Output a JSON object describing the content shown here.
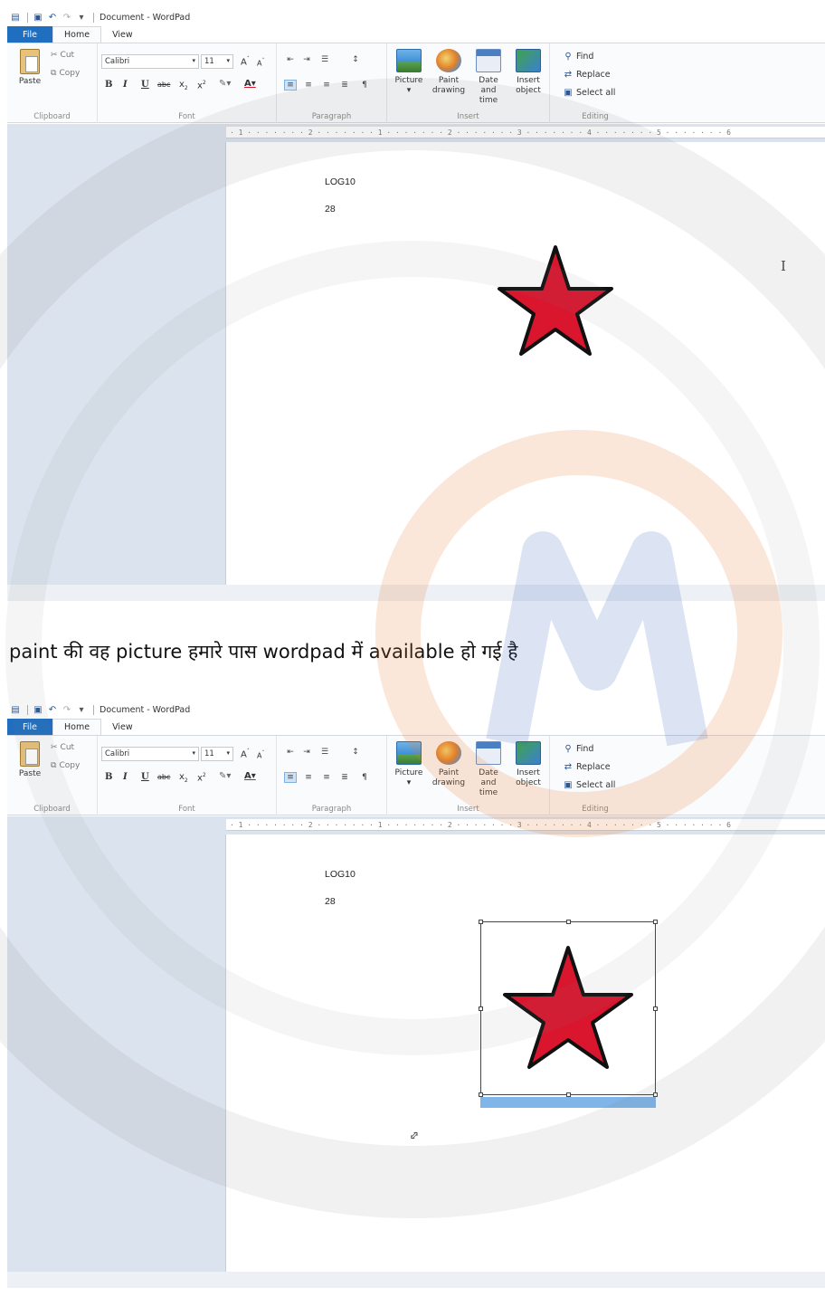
{
  "app": {
    "title": "Document - WordPad",
    "tabs": [
      "File",
      "Home",
      "View"
    ],
    "active_tab": "Home"
  },
  "ribbon": {
    "clipboard": {
      "paste": "Paste",
      "cut": "Cut",
      "copy": "Copy",
      "label": "Clipboard"
    },
    "font": {
      "family": "Calibri",
      "size": "11",
      "label": "Font"
    },
    "paragraph": {
      "label": "Paragraph"
    },
    "insert": {
      "label": "Insert",
      "picture": "Picture",
      "paint_line1": "Paint",
      "paint_line2": "drawing",
      "date_line1": "Date and",
      "date_line2": "time",
      "object_line1": "Insert",
      "object_line2": "object"
    },
    "editing": {
      "label": "Editing",
      "find": "Find",
      "replace": "Replace",
      "select_all": "Select all"
    }
  },
  "ruler": {
    "text": "· 1 · · · · · · · 2 · · · · · · · 1 · · · · · · · 2 · · · · · · · 3 · · · · · · · 4 · · · · · · · 5 · · · · · · · 6"
  },
  "document": {
    "line1": "LOG10",
    "line2": "28"
  },
  "caption": "paint की वह picture हमारे पास wordpad में available हो गई है",
  "colors": {
    "accent": "#1f6ebf",
    "star_fill": "#d9162e",
    "selection_strip": "#7fb5e8",
    "doc_background": "#dbe3ee"
  },
  "icons": [
    "save-icon",
    "undo-icon",
    "redo-icon",
    "paste-icon",
    "picture-icon",
    "paint-drawing-icon",
    "date-time-icon",
    "insert-object-icon",
    "find-icon",
    "replace-icon",
    "select-all-icon",
    "star-picture",
    "ibeam-cursor-icon",
    "resize-cursor-icon"
  ]
}
